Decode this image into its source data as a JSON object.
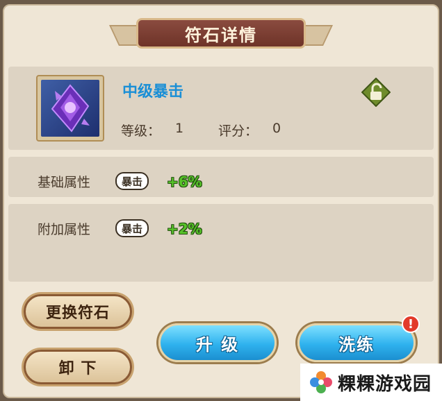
{
  "dialog": {
    "title": "符石详情"
  },
  "rune": {
    "name": "中级暴击",
    "level_label": "等级：",
    "level_value": "1",
    "score_label": "评分：",
    "score_value": "0",
    "icon": "purple-crystal-rune-icon",
    "lock_icon": "unlock-icon"
  },
  "attributes": {
    "base": {
      "label": "基础属性",
      "badge": "暴击",
      "value": "+6%"
    },
    "extra": {
      "label": "附加属性",
      "badge": "暴击",
      "value": "+2%"
    }
  },
  "buttons": {
    "replace": "更换符石",
    "unequip": "卸 下",
    "upgrade": "升 级",
    "refine": "洗练",
    "refine_alert": "!"
  },
  "watermark": {
    "text": "粿粿游戏园"
  },
  "colors": {
    "rune_name": "#1a8fd6",
    "bonus_green": "#56c229",
    "title_plate": "#7a3e33",
    "blue_button": "#2fb2ee"
  }
}
